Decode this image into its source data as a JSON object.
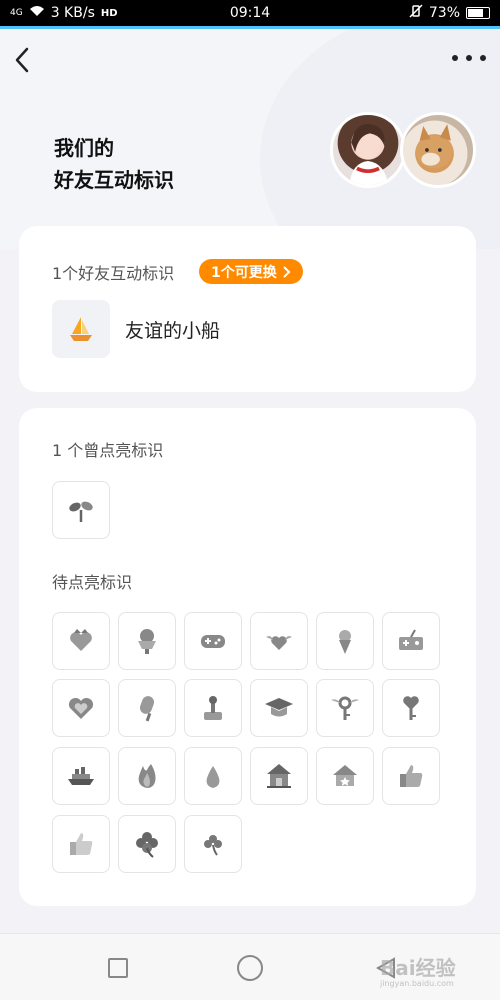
{
  "status_bar": {
    "network": "4G",
    "speed": "3 KB/s",
    "hd": "HD",
    "time": "09:14",
    "battery": "73%"
  },
  "header": {
    "title_line1": "我们的",
    "title_line2": "好友互动标识"
  },
  "current_section": {
    "heading": "1个好友互动标识",
    "badge_label": "1个可更换",
    "current_icon": "sailboat-icon",
    "current_name": "友谊的小船"
  },
  "lit_section": {
    "heading": "1 个曾点亮标识",
    "icons": [
      "sprout-icon"
    ]
  },
  "pending_section": {
    "heading": "待点亮标识",
    "icons": [
      "heart-crown-icon",
      "ice-cream-sundae-icon",
      "gamepad-icon",
      "winged-heart-icon",
      "ice-cream-cone-icon",
      "game-console-icon",
      "heart-icon",
      "popsicle-icon",
      "joystick-icon",
      "graduation-cap-icon",
      "winged-key-icon",
      "heart-key-icon",
      "ship-icon",
      "fire-icon",
      "flame-icon",
      "house-icon",
      "star-house-icon",
      "thumbs-up-icon",
      "thumbs-up-light-icon",
      "clover-icon",
      "clover-small-icon"
    ]
  },
  "watermark": {
    "brand": "Bai经验",
    "url": "jingyan.baidu.com"
  },
  "colors": {
    "accent": "#ff8a00",
    "status_accent": "#4fc3f7",
    "background": "#f2f2f7"
  }
}
